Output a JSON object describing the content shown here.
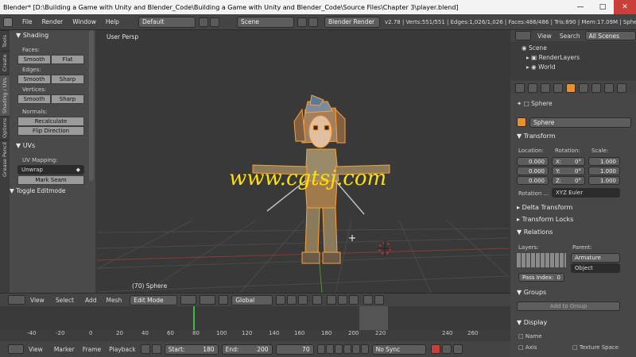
{
  "titlebar": {
    "title": "Blender* [D:\\Building a Game with Unity and Blender_Code\\Building a Game with Unity and Blender_Code\\Source Files\\Chapter 3\\player.blend]"
  },
  "menu": [
    "File",
    "Render",
    "Window",
    "Help"
  ],
  "layout": "Default",
  "scene": "Scene",
  "engine": "Blender Render",
  "stats": "v2.78 | Verts:551/551 | Edges:1,026/1,026 | Faces:486/486 | Tris:890 | Mem:17.09M | Sphe",
  "left_tabs": [
    "Tools",
    "Create",
    "Shading / UVs",
    "Options",
    "Grease Pencil"
  ],
  "shading": {
    "header": "Shading",
    "faces": "Faces:",
    "edges": "Edges:",
    "vertices": "Vertices:",
    "smooth": "Smooth",
    "flat": "Flat",
    "sharp": "Sharp",
    "normals": "Normals:",
    "recalculate": "Recalculate",
    "flip": "Flip Direction"
  },
  "uvs": {
    "header": "UVs",
    "mapping": "UV Mapping:",
    "unwrap": "Unwrap",
    "markseam": "Mark Seam",
    "toggle": "Toggle Editmode"
  },
  "viewport": {
    "view_label": "User Persp",
    "object_label": "(70) Sphere",
    "watermark": "www.cgtsj.com"
  },
  "v3dheader": {
    "view": "View",
    "select": "Select",
    "add": "Add",
    "mesh": "Mesh",
    "mode": "Edit Mode",
    "orientation": "Global"
  },
  "timeline": {
    "ticks": [
      "-40",
      "-20",
      "0",
      "20",
      "40",
      "60",
      "80",
      "100",
      "120",
      "140",
      "160",
      "180",
      "200",
      "220",
      "240",
      "260"
    ]
  },
  "bottom": {
    "view": "View",
    "marker": "Marker",
    "frame": "Frame",
    "playback": "Playback",
    "start": "Start:",
    "start_val": "180",
    "end": "End:",
    "end_val": "200",
    "current": "70",
    "sync": "No Sync"
  },
  "outliner": {
    "view": "View",
    "search": "Search",
    "all_scenes": "All Scenes",
    "scene": "Scene",
    "renderlayers": "RenderLayers",
    "world": "World"
  },
  "props": {
    "breadcrumb": "Sphere",
    "name": "Sphere",
    "transform": "Transform",
    "location": "Location:",
    "rotation": "Rotation:",
    "scale": "Scale:",
    "loc": [
      "0.000",
      "0.000",
      "0.000"
    ],
    "rot": [
      [
        "X:",
        "0°"
      ],
      [
        "Y:",
        "0°"
      ],
      [
        "Z:",
        "0°"
      ]
    ],
    "scl": [
      "1.000",
      "1.000",
      "1.000"
    ],
    "rotmode_lbl": "Rotation ...",
    "rotmode": "XYZ Euler",
    "delta": "Delta Transform",
    "locks": "Transform Locks",
    "relations": "Relations",
    "layers": "Layers:",
    "parent": "Parent:",
    "armature": "Armature",
    "object": "Object",
    "passindex": "Pass Index:",
    "passval": "0",
    "groups": "Groups",
    "addgroup": "Add to Group",
    "display": "Display",
    "name_chk": "Name",
    "axis_chk": "Axis",
    "texspace": "Texture Space"
  },
  "colors": {
    "accent": "#e8902a",
    "select": "#ffa030",
    "frame": "#3fbf3f"
  }
}
